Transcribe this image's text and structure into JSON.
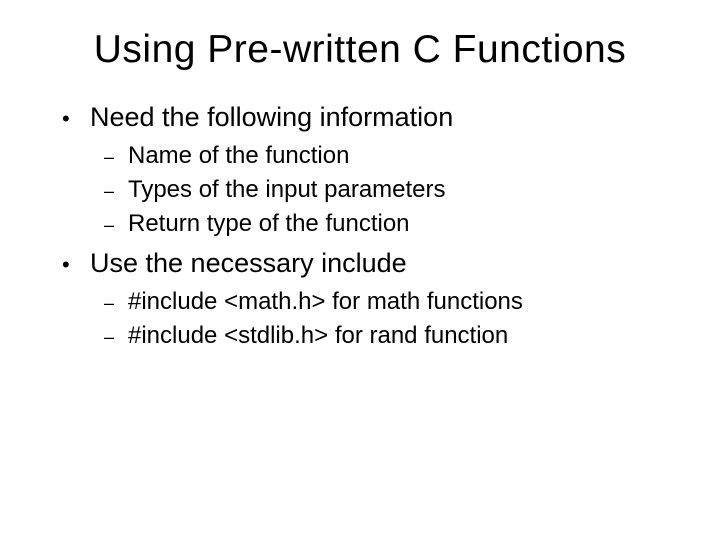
{
  "slide": {
    "title": "Using Pre-written C Functions",
    "bullets": [
      {
        "text": "Need the following information",
        "sub": [
          "Name of the function",
          "Types of the input parameters",
          "Return type of the function"
        ]
      },
      {
        "text": "Use the necessary include",
        "sub": [
          "#include <math.h> for math functions",
          "#include <stdlib.h> for rand function"
        ]
      }
    ]
  }
}
